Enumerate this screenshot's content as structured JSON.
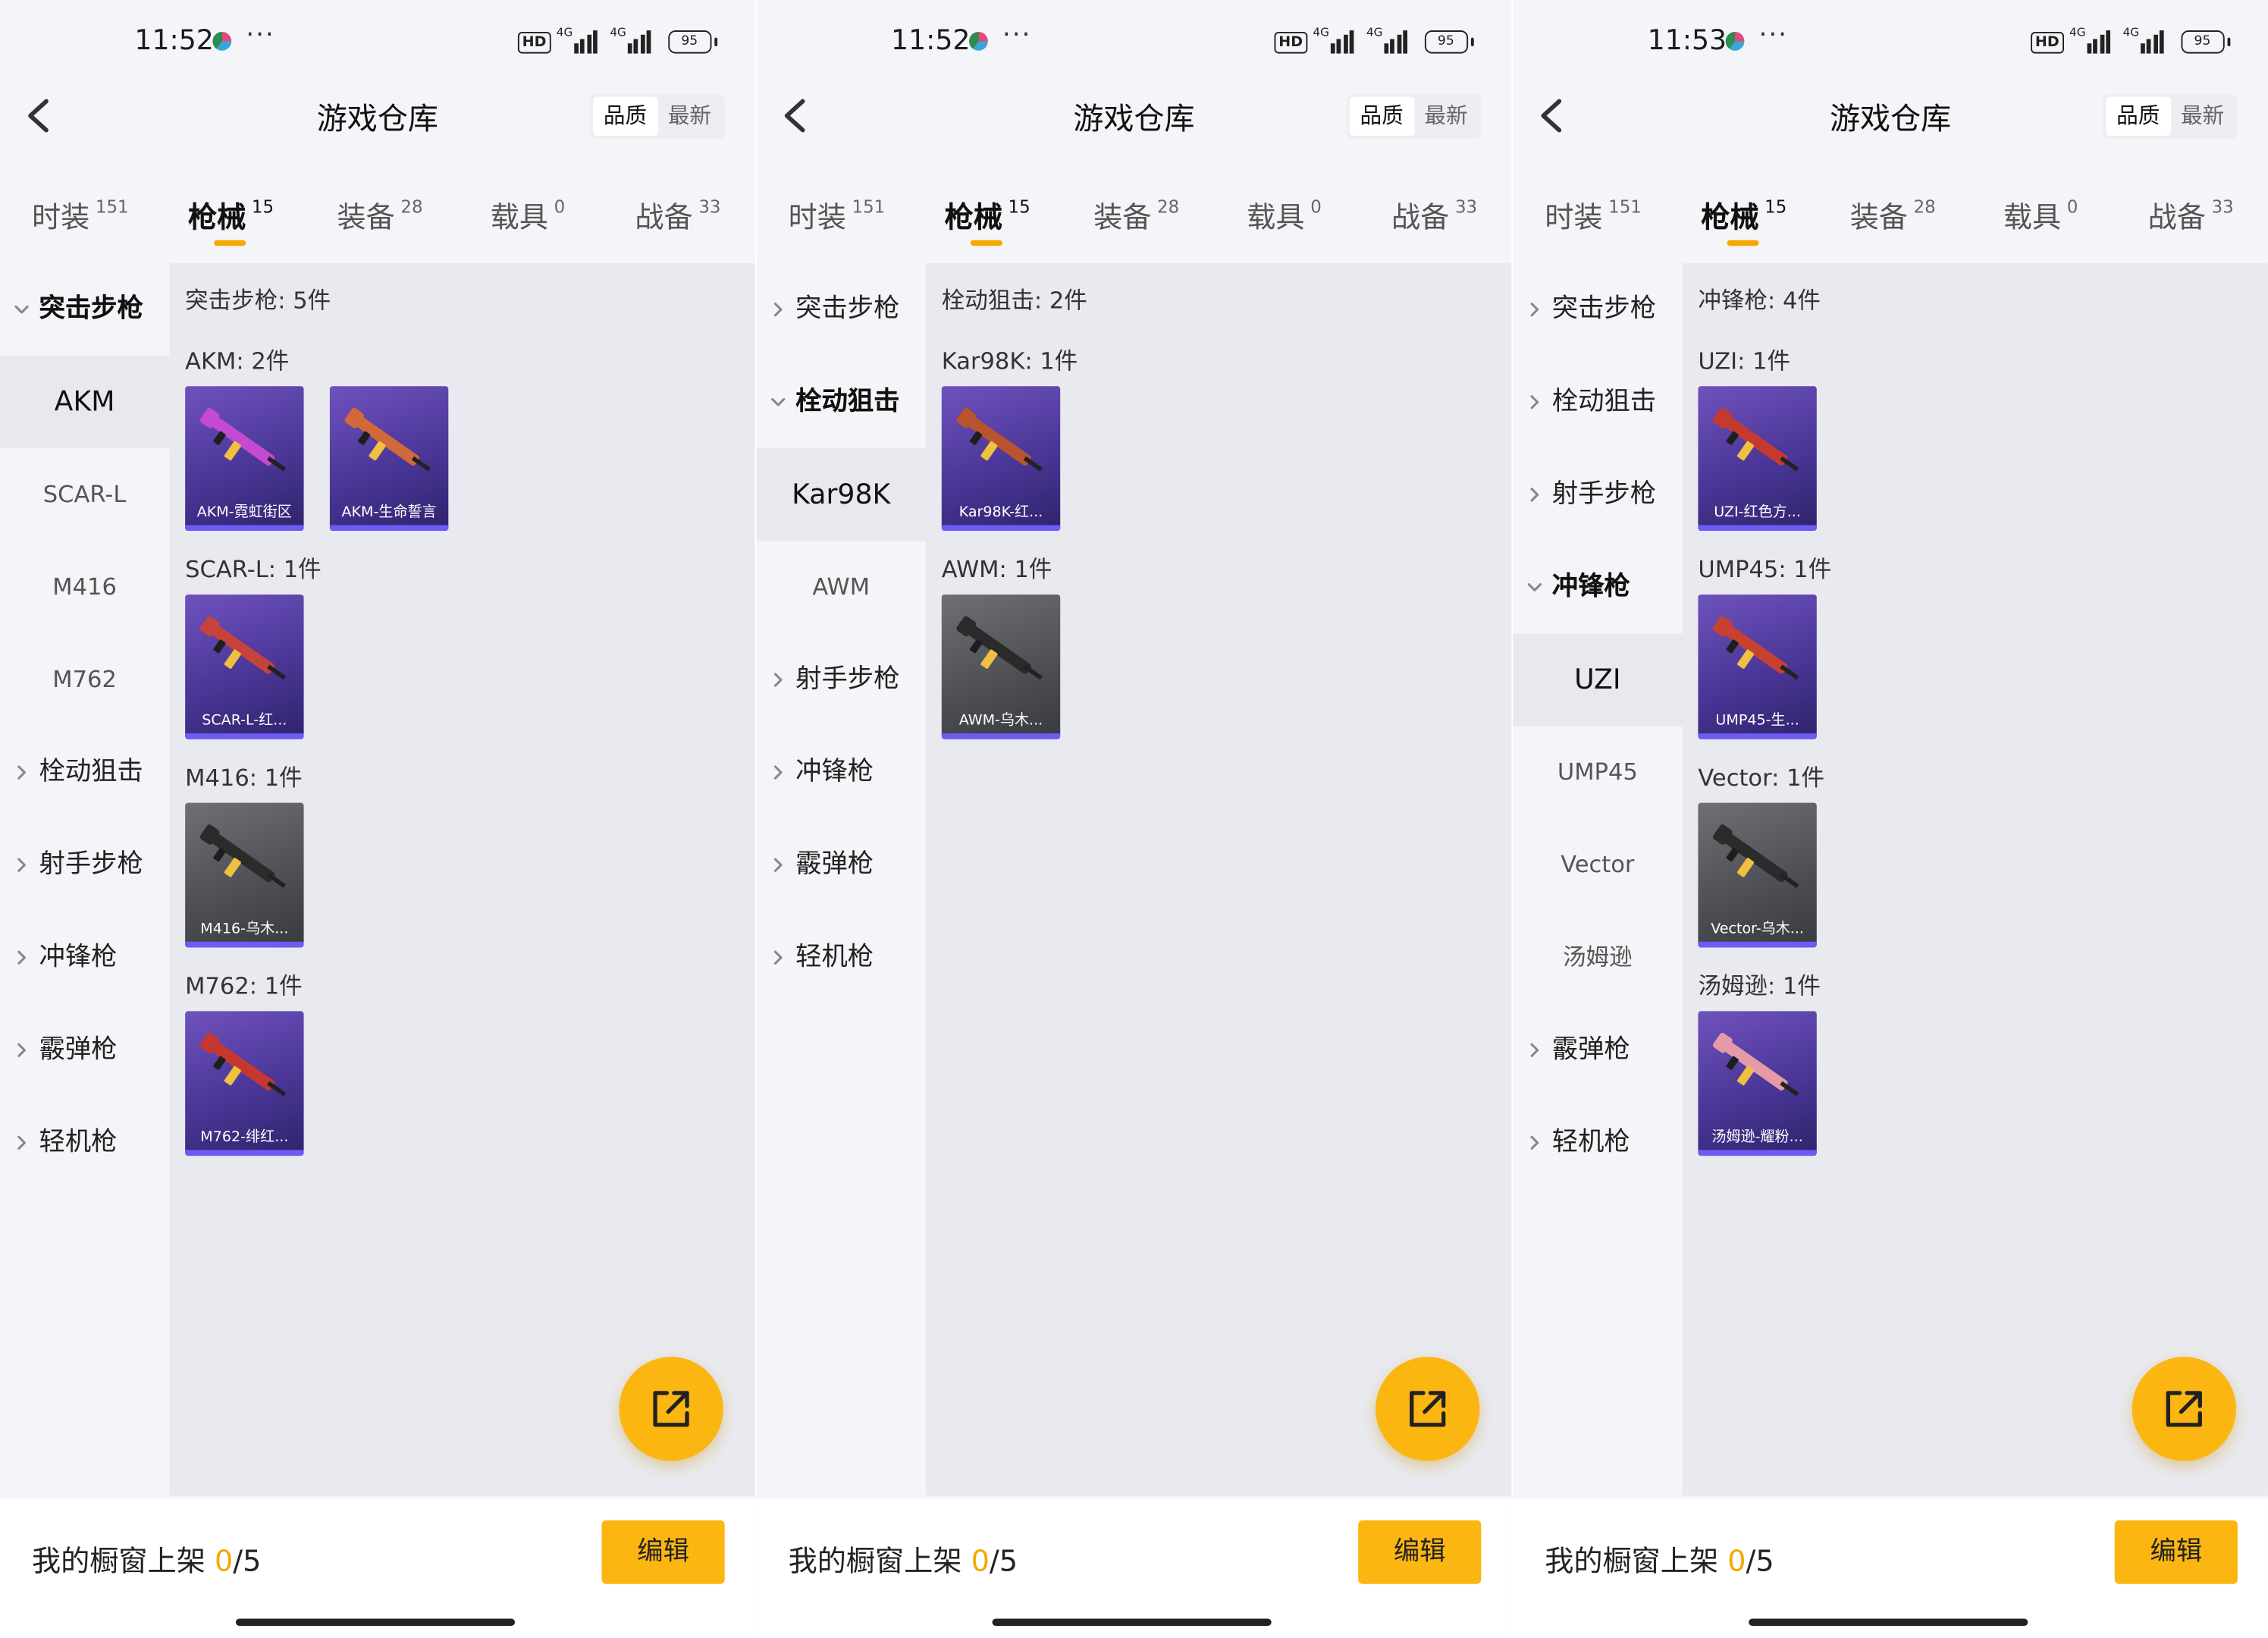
{
  "screens": [
    {
      "status": {
        "time": "11:52",
        "more": "···",
        "hd": "HD",
        "net1": "4G",
        "net2": "4G",
        "battery": "95"
      },
      "nav": {
        "title": "游戏仓库",
        "sort_quality": "品质",
        "sort_newest": "最新"
      },
      "tabs": [
        {
          "label": "时装",
          "count": "151"
        },
        {
          "label": "枪械",
          "count": "15"
        },
        {
          "label": "装备",
          "count": "28"
        },
        {
          "label": "载具",
          "count": "0"
        },
        {
          "label": "战备",
          "count": "33"
        }
      ],
      "sidebar": [
        {
          "label": "突击步枪",
          "kind": "category",
          "open": true
        },
        {
          "label": "AKM",
          "kind": "sub",
          "selected": true
        },
        {
          "label": "SCAR-L",
          "kind": "sub"
        },
        {
          "label": "M416",
          "kind": "sub"
        },
        {
          "label": "M762",
          "kind": "sub"
        },
        {
          "label": "栓动狙击",
          "kind": "category"
        },
        {
          "label": "射手步枪",
          "kind": "category"
        },
        {
          "label": "冲锋枪",
          "kind": "category"
        },
        {
          "label": "霰弹枪",
          "kind": "category"
        },
        {
          "label": "轻机枪",
          "kind": "category"
        }
      ],
      "content": {
        "header": "突击步枪: 5件",
        "groups": [
          {
            "title": "AKM: 2件",
            "items": [
              {
                "name": "AKM-霓虹街区",
                "style": "purple",
                "gun": "#c44ad1"
              },
              {
                "name": "AKM-生命誓言",
                "style": "purple",
                "gun": "#d06a3a"
              }
            ]
          },
          {
            "title": "SCAR-L: 1件",
            "items": [
              {
                "name": "SCAR-L-红...",
                "style": "purple",
                "gun": "#c5433b"
              }
            ]
          },
          {
            "title": "M416: 1件",
            "items": [
              {
                "name": "M416-乌木...",
                "style": "gray",
                "gun": "#2b2b2b"
              }
            ]
          },
          {
            "title": "M762: 1件",
            "items": [
              {
                "name": "M762-绯红...",
                "style": "purple",
                "gun": "#c8372f"
              }
            ]
          }
        ]
      },
      "bottom": {
        "label": "我的橱窗上架",
        "current": "0",
        "total": "/5",
        "edit": "编辑"
      }
    },
    {
      "status": {
        "time": "11:52",
        "more": "···",
        "hd": "HD",
        "net1": "4G",
        "net2": "4G",
        "battery": "95"
      },
      "nav": {
        "title": "游戏仓库",
        "sort_quality": "品质",
        "sort_newest": "最新"
      },
      "tabs": [
        {
          "label": "时装",
          "count": "151"
        },
        {
          "label": "枪械",
          "count": "15"
        },
        {
          "label": "装备",
          "count": "28"
        },
        {
          "label": "载具",
          "count": "0"
        },
        {
          "label": "战备",
          "count": "33"
        }
      ],
      "sidebar": [
        {
          "label": "突击步枪",
          "kind": "category"
        },
        {
          "label": "栓动狙击",
          "kind": "category",
          "open": true
        },
        {
          "label": "Kar98K",
          "kind": "sub",
          "selected": true
        },
        {
          "label": "AWM",
          "kind": "sub"
        },
        {
          "label": "射手步枪",
          "kind": "category"
        },
        {
          "label": "冲锋枪",
          "kind": "category"
        },
        {
          "label": "霰弹枪",
          "kind": "category"
        },
        {
          "label": "轻机枪",
          "kind": "category"
        }
      ],
      "content": {
        "header": "栓动狙击: 2件",
        "groups": [
          {
            "title": "Kar98K: 1件",
            "items": [
              {
                "name": "Kar98K-红...",
                "style": "purple",
                "gun": "#b8542e"
              }
            ]
          },
          {
            "title": "AWM: 1件",
            "items": [
              {
                "name": "AWM-乌木...",
                "style": "gray",
                "gun": "#2a2a2a"
              }
            ]
          }
        ]
      },
      "bottom": {
        "label": "我的橱窗上架",
        "current": "0",
        "total": "/5",
        "edit": "编辑"
      }
    },
    {
      "status": {
        "time": "11:53",
        "more": "···",
        "hd": "HD",
        "net1": "4G",
        "net2": "4G",
        "battery": "95"
      },
      "nav": {
        "title": "游戏仓库",
        "sort_quality": "品质",
        "sort_newest": "最新"
      },
      "tabs": [
        {
          "label": "时装",
          "count": "151"
        },
        {
          "label": "枪械",
          "count": "15"
        },
        {
          "label": "装备",
          "count": "28"
        },
        {
          "label": "载具",
          "count": "0"
        },
        {
          "label": "战备",
          "count": "33"
        }
      ],
      "sidebar": [
        {
          "label": "突击步枪",
          "kind": "category"
        },
        {
          "label": "栓动狙击",
          "kind": "category"
        },
        {
          "label": "射手步枪",
          "kind": "category"
        },
        {
          "label": "冲锋枪",
          "kind": "category",
          "open": true
        },
        {
          "label": "UZI",
          "kind": "sub",
          "selected": true
        },
        {
          "label": "UMP45",
          "kind": "sub"
        },
        {
          "label": "Vector",
          "kind": "sub"
        },
        {
          "label": "汤姆逊",
          "kind": "sub"
        },
        {
          "label": "霰弹枪",
          "kind": "category"
        },
        {
          "label": "轻机枪",
          "kind": "category"
        }
      ],
      "content": {
        "header": "冲锋枪: 4件",
        "groups": [
          {
            "title": "UZI: 1件",
            "items": [
              {
                "name": "UZI-红色方...",
                "style": "purple",
                "gun": "#c53a2e"
              }
            ]
          },
          {
            "title": "UMP45: 1件",
            "items": [
              {
                "name": "UMP45-生...",
                "style": "purple",
                "gun": "#c8402f"
              }
            ]
          },
          {
            "title": "Vector: 1件",
            "items": [
              {
                "name": "Vector-乌木...",
                "style": "gray",
                "gun": "#2b2b2b"
              }
            ]
          },
          {
            "title": "汤姆逊: 1件",
            "items": [
              {
                "name": "汤姆逊-耀粉...",
                "style": "purple",
                "gun": "#e59aa8"
              }
            ]
          }
        ]
      },
      "bottom": {
        "label": "我的橱窗上架",
        "current": "0",
        "total": "/5",
        "edit": "编辑"
      }
    }
  ]
}
